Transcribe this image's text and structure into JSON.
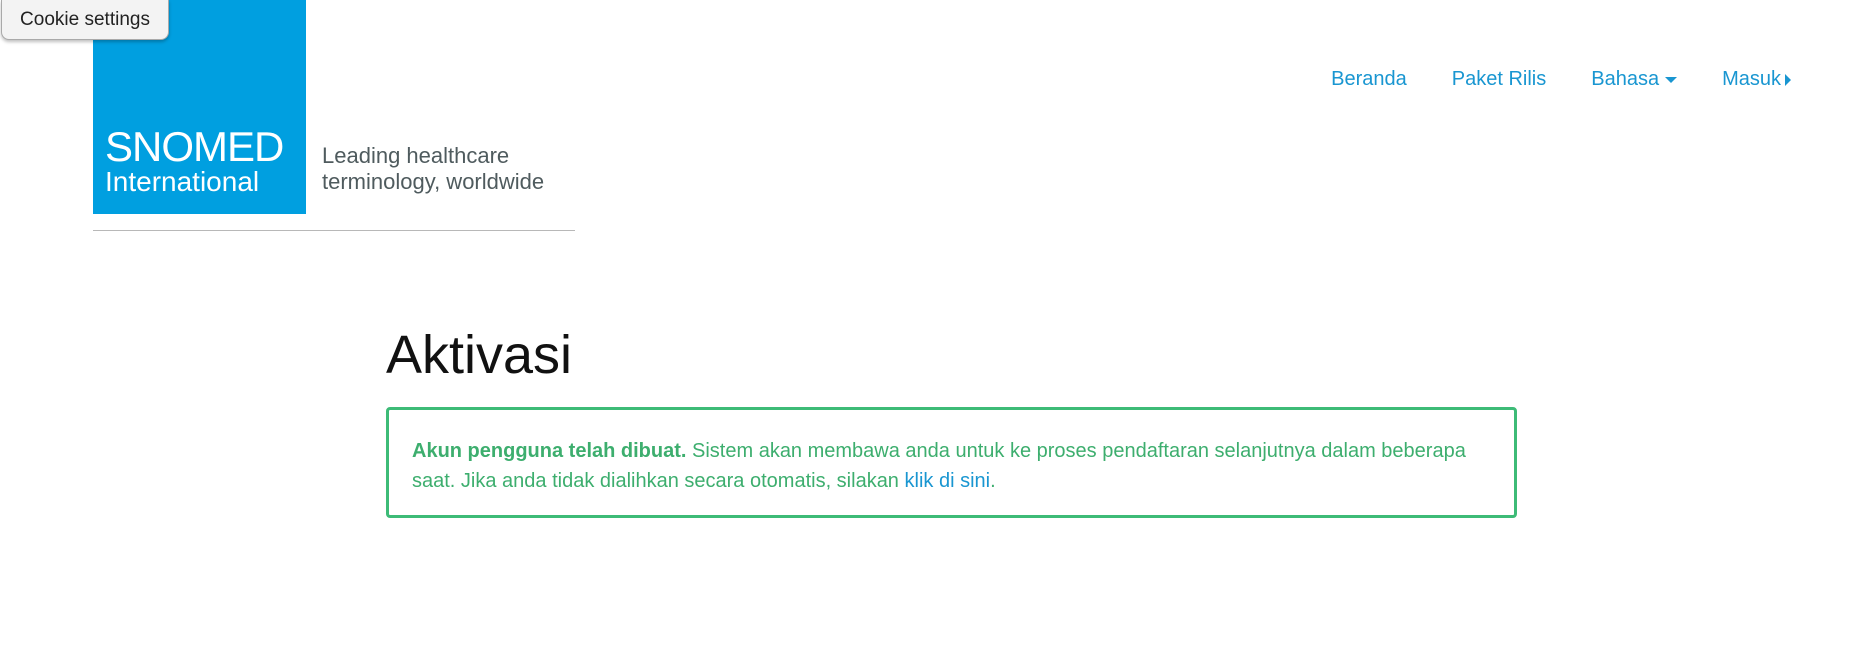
{
  "cookie_button": {
    "label": "Cookie settings"
  },
  "logo": {
    "brand_line1": "SNOMED",
    "brand_line2": "International",
    "tagline_line1": "Leading healthcare",
    "tagline_line2": "terminology, worldwide",
    "brand_color": "#009fe0"
  },
  "nav": {
    "home": "Beranda",
    "release_packages": "Paket Rilis",
    "language": "Bahasa",
    "login": "Masuk",
    "link_color": "#1996d1"
  },
  "main": {
    "title": "Aktivasi",
    "alert": {
      "bold_text": "Akun pengguna telah dibuat.",
      "body_text": " Sistem akan membawa anda untuk ke proses pendaftaran selanjutnya dalam beberapa saat. Jika anda tidak dialihkan secara otomatis, silakan ",
      "link_text": "klik di sini",
      "trailing_text": ".",
      "border_color": "#3dbb77",
      "text_color": "#3dae6e"
    }
  }
}
